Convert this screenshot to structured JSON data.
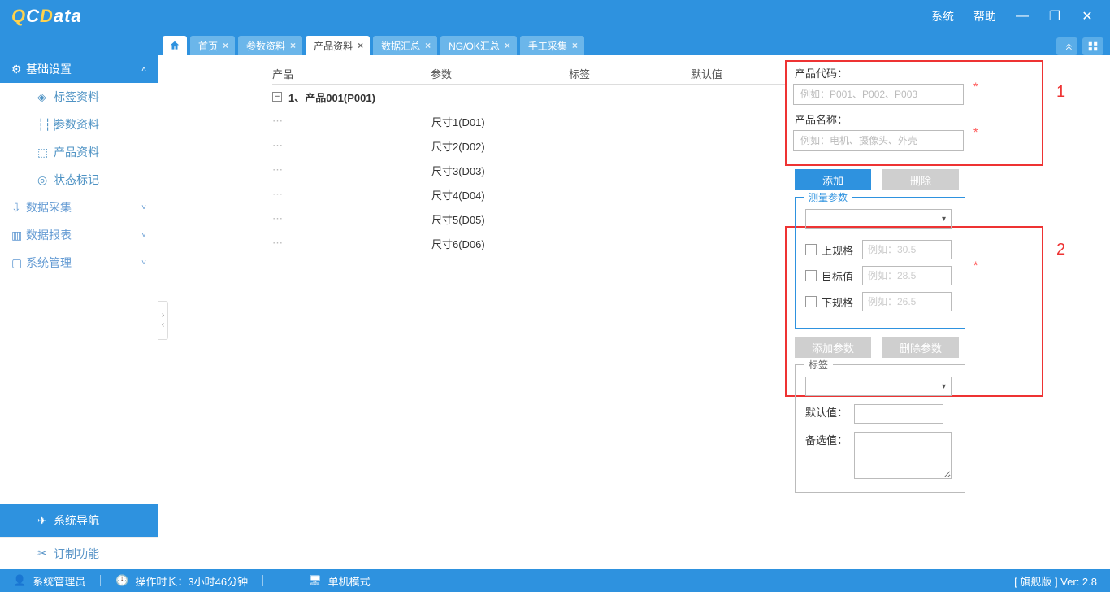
{
  "app": {
    "system": "系统",
    "help": "帮助"
  },
  "tabs": {
    "home": "首页",
    "param": "参数资料",
    "product": "产品资料",
    "summary": "数据汇总",
    "ngok": "NG/OK汇总",
    "manual": "手工采集"
  },
  "sidebar": {
    "base": "基础设置",
    "items": {
      "tag": "标签资料",
      "param": "参数资料",
      "product": "产品资料",
      "status": "状态标记"
    },
    "collect": "数据采集",
    "report": "数据报表",
    "sys": "系统管理",
    "nav": "系统导航",
    "custom": "订制功能"
  },
  "tree": {
    "h_product": "产品",
    "h_param": "参数",
    "h_tag": "标签",
    "h_default": "默认值",
    "group": "1、产品001(P001)",
    "rows": [
      "尺寸1(D01)",
      "尺寸2(D02)",
      "尺寸3(D03)",
      "尺寸4(D04)",
      "尺寸5(D05)",
      "尺寸6(D06)"
    ]
  },
  "form": {
    "code_lbl": "产品代码：",
    "code_ph": "例如：P001、P002、P003",
    "name_lbl": "产品名称：",
    "name_ph": "例如：电机、摄像头、外壳",
    "add": "添加",
    "del": "删除",
    "measure": "测量参数",
    "upper": "上规格",
    "upper_ph": "例如：30.5",
    "target": "目标值",
    "target_ph": "例如：28.5",
    "lower": "下规格",
    "lower_ph": "例如：26.5",
    "addp": "添加参数",
    "delp": "删除参数",
    "tag": "标签",
    "default": "默认值：",
    "alt": "备选值："
  },
  "anno": {
    "a1": "1",
    "a2": "2"
  },
  "status": {
    "user": "系统管理员",
    "runtime_lbl": "操作时长：",
    "runtime": "3小时46分钟",
    "mode": "单机模式",
    "ver": "[ 旗舰版 ] Ver: 2.8"
  }
}
